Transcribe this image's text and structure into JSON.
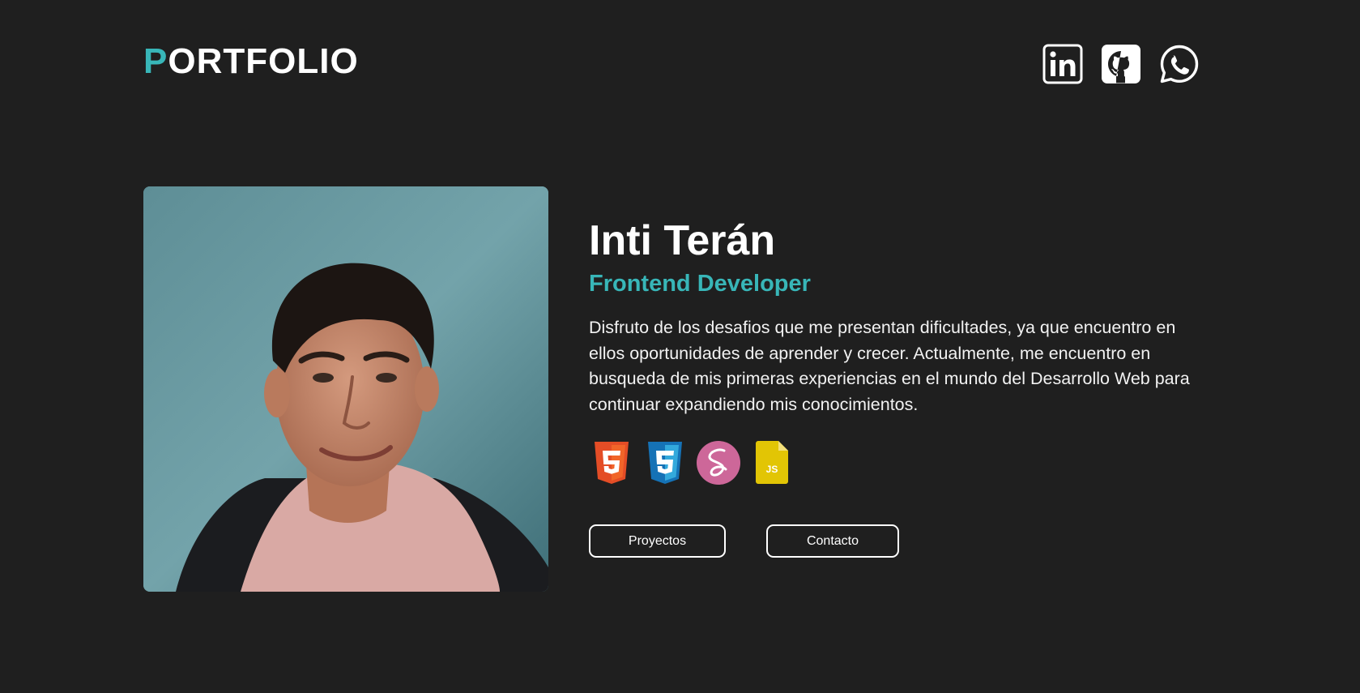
{
  "header": {
    "logo_first_letter": "P",
    "logo_rest": "ORTFOLIO",
    "accent_color": "#38b6b8",
    "socials": [
      {
        "name": "linkedin-icon"
      },
      {
        "name": "github-icon"
      },
      {
        "name": "whatsapp-icon"
      }
    ]
  },
  "hero": {
    "name": "Inti Terán",
    "role": "Frontend Developer",
    "bio": "Disfruto de los desafios que me presentan dificultades, ya que encuentro en ellos oportunidades de aprender y crecer. Actualmente, me encuentro en busqueda de mis primeras experiencias en el mundo del Desarrollo Web para continuar expandiendo mis conocimientos.",
    "tech_icons": [
      "html5-icon",
      "css3-icon",
      "sass-icon",
      "javascript-icon"
    ],
    "javascript_label": "JS",
    "buttons": {
      "projects": "Proyectos",
      "contact": "Contacto"
    }
  },
  "colors": {
    "background": "#1f1f1f",
    "accent": "#38b6b8",
    "html": "#e44d26",
    "css": "#2196f3",
    "sass": "#cd6799",
    "js": "#e2c505"
  }
}
